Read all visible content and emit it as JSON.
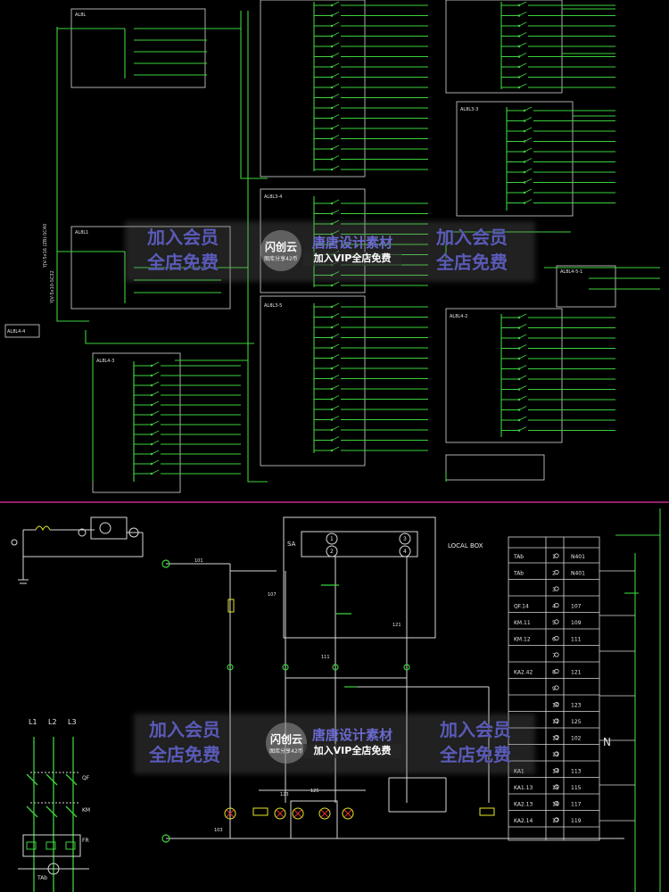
{
  "colors": {
    "green": "#3cd23c",
    "white": "#d8d8d8",
    "yellow": "#e6e62a",
    "red": "#e23030",
    "magenta": "#c8288c",
    "watermark": "#5a5ab8"
  },
  "watermarks": {
    "join_member": "加入会员",
    "free_shop": "全店免费",
    "shop_name": "唐唐设计素材",
    "vip_free": "加入VIP全店免费",
    "badge_name": "闪创云",
    "badge_sub": "图库分享42币"
  },
  "labels": {
    "ak_boxes": [
      "AL8L",
      "AL8L3-4",
      "AL8L1",
      "AL8L3-5",
      "AL8L3-3",
      "AL8L4-3",
      "AL8L4-2",
      "AL8L4-5-1",
      "AL8L4-4"
    ],
    "local_box": "LOCAL BOX",
    "sa": "SA",
    "phases": [
      "L1",
      "L2",
      "L3"
    ],
    "qf": "QF",
    "km": "KM",
    "fr": "FR",
    "n": "N",
    "tab": "TAb",
    "wires": [
      "101",
      "107",
      "111",
      "121",
      "103",
      "123",
      "125"
    ],
    "switch_nums": [
      "1",
      "2",
      "3",
      "4"
    ]
  },
  "terminal_table": {
    "rows": [
      {
        "left": "TAb",
        "num": "1",
        "right": "N401"
      },
      {
        "left": "TAb",
        "num": "2",
        "right": "N401"
      },
      {
        "left": "",
        "num": "3",
        "right": ""
      },
      {
        "left": "QF.14",
        "num": "4",
        "right": "107"
      },
      {
        "left": "KM.11",
        "num": "5",
        "right": "109"
      },
      {
        "left": "KM.12",
        "num": "6",
        "right": "111"
      },
      {
        "left": "",
        "num": "7",
        "right": ""
      },
      {
        "left": "KA2.42",
        "num": "8",
        "right": "121"
      },
      {
        "left": "",
        "num": "9",
        "right": ""
      },
      {
        "left": "",
        "num": "10",
        "right": "123"
      },
      {
        "left": "",
        "num": "11",
        "right": "125"
      },
      {
        "left": "",
        "num": "12",
        "right": "102"
      },
      {
        "left": "",
        "num": "13",
        "right": ""
      },
      {
        "left": "KA1",
        "num": "14",
        "right": "113"
      },
      {
        "left": "KA1.13",
        "num": "15",
        "right": "115"
      },
      {
        "left": "KA2.13",
        "num": "16",
        "right": "117"
      },
      {
        "left": "KA2.14",
        "num": "17",
        "right": "119"
      }
    ]
  }
}
